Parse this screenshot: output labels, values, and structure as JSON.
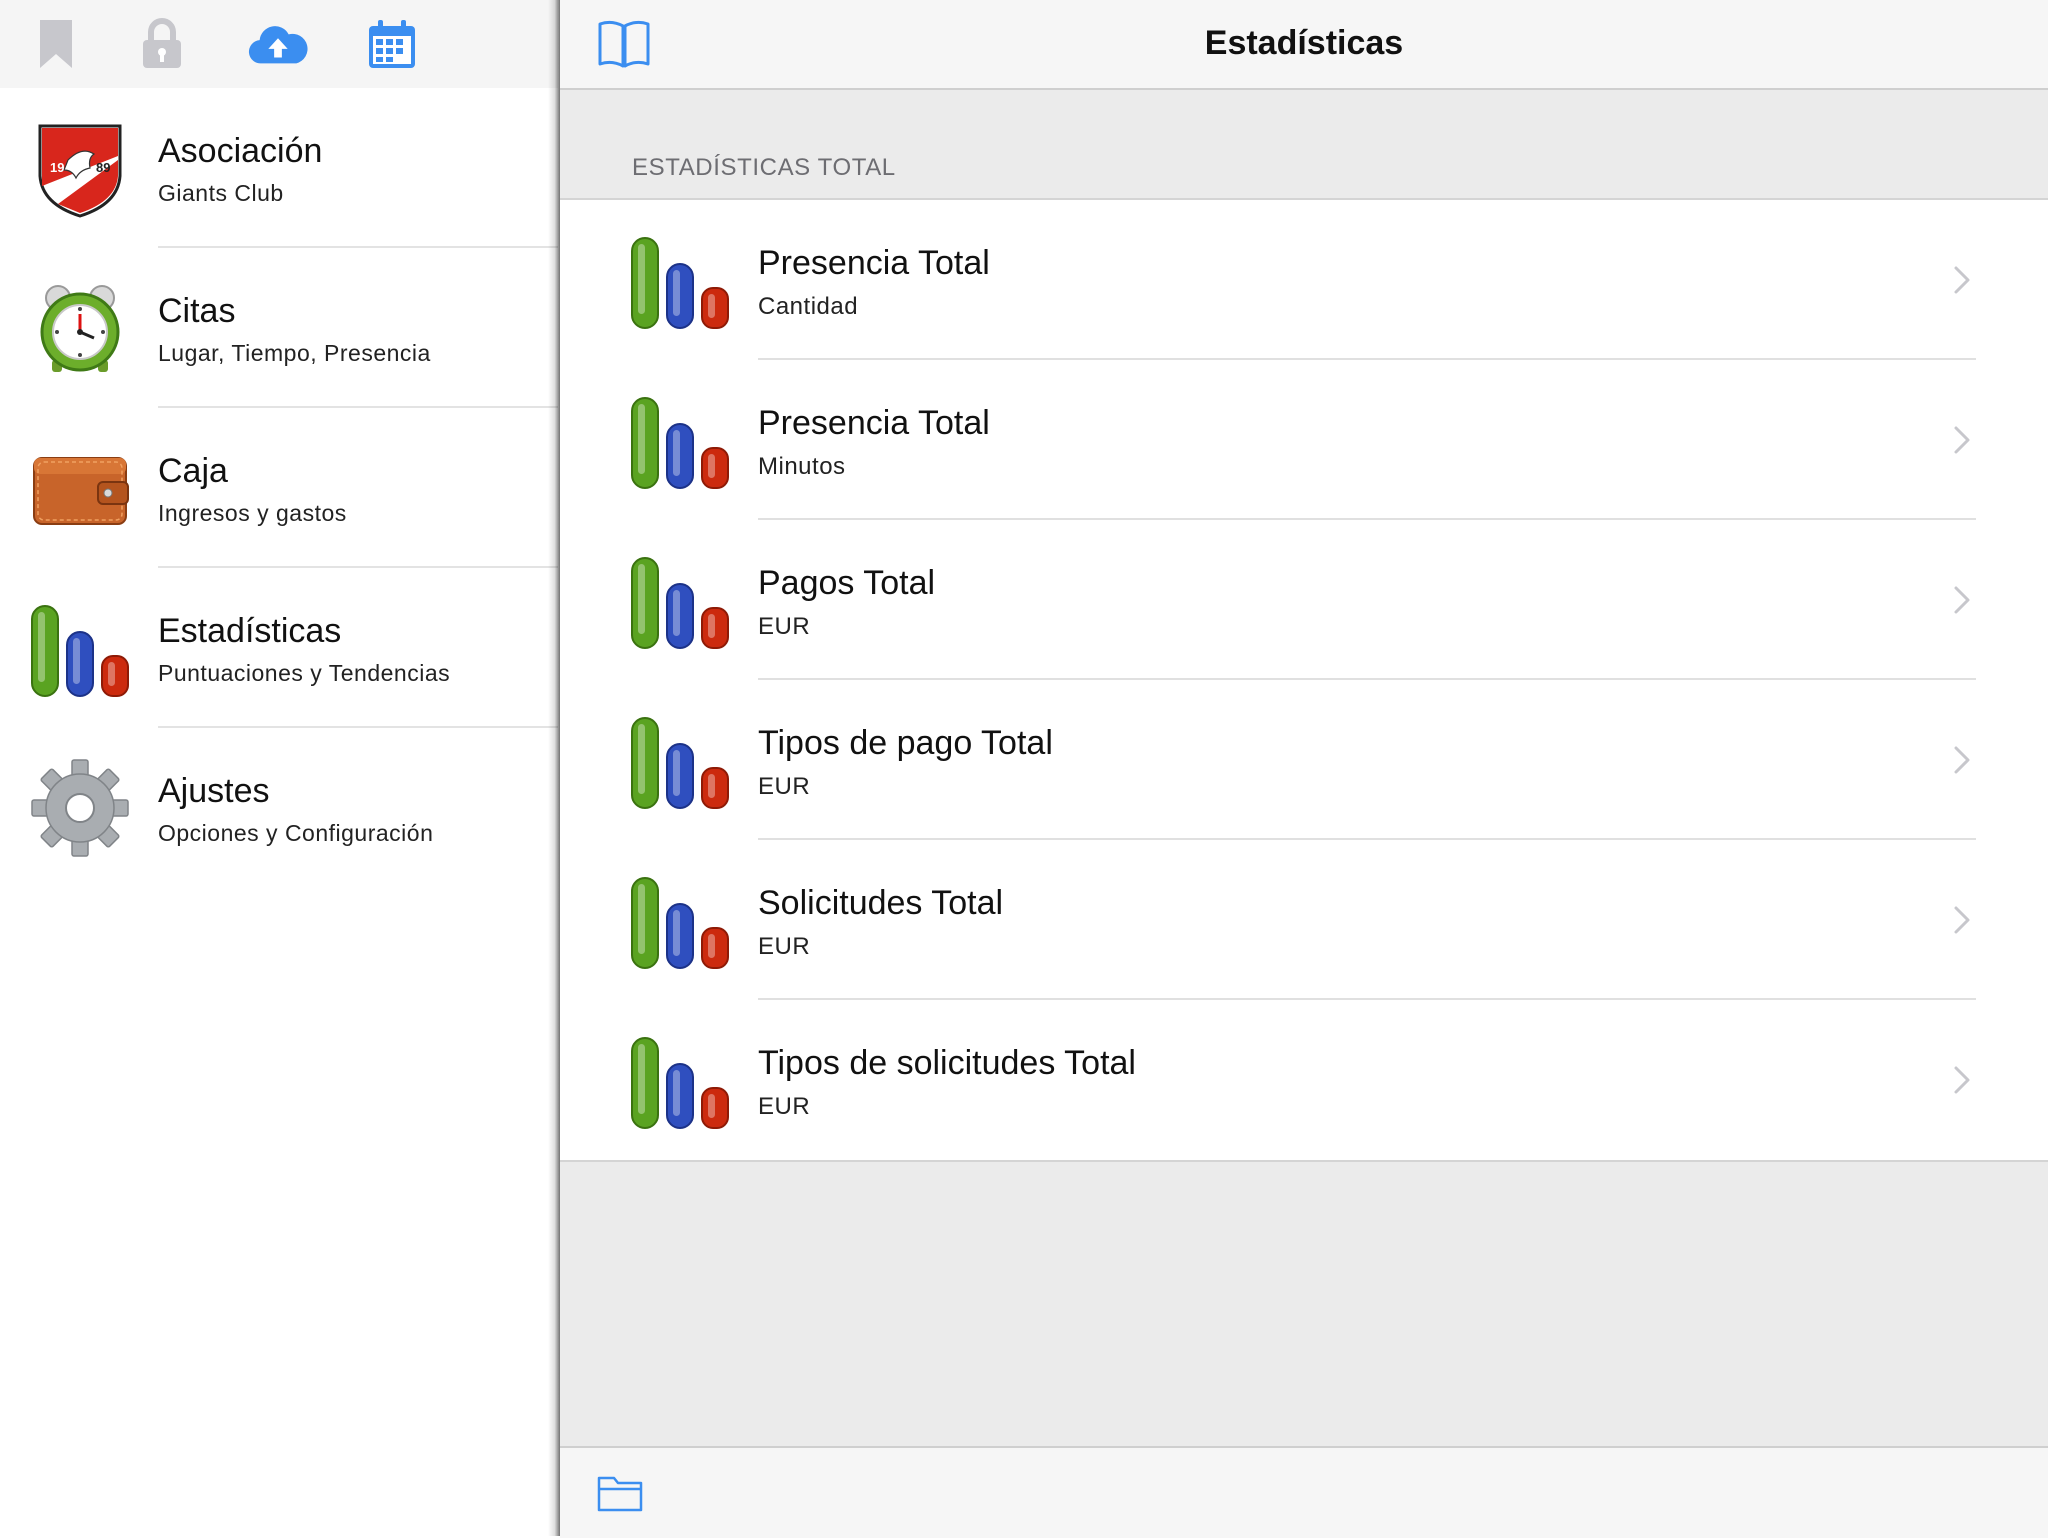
{
  "sidebar": {
    "toolbar": {
      "icons": [
        "bookmark-icon",
        "lock-icon",
        "cloud-upload-icon",
        "calendar-icon"
      ],
      "colors": {
        "inactive": "#c7c7cc",
        "active": "#3b8ef0"
      }
    },
    "items": [
      {
        "title": "Asociación",
        "subtitle": "Giants Club",
        "icon": "club-crest-icon"
      },
      {
        "title": "Citas",
        "subtitle": "Lugar, Tiempo, Presencia",
        "icon": "alarm-clock-icon"
      },
      {
        "title": "Caja",
        "subtitle": "Ingresos y gastos",
        "icon": "wallet-icon"
      },
      {
        "title": "Estadísticas",
        "subtitle": "Puntuaciones y Tendencias",
        "icon": "bar-chart-icon"
      },
      {
        "title": "Ajustes",
        "subtitle": "Opciones y Configuración",
        "icon": "gear-icon"
      }
    ],
    "crest_text": {
      "top": "",
      "left": "19",
      "right": "89"
    }
  },
  "main": {
    "title": "Estadísticas",
    "section_header": "ESTADÍSTICAS TOTAL",
    "rows": [
      {
        "title": "Presencia Total",
        "subtitle": "Cantidad"
      },
      {
        "title": "Presencia Total",
        "subtitle": "Minutos"
      },
      {
        "title": "Pagos Total",
        "subtitle": "EUR"
      },
      {
        "title": "Tipos de pago Total",
        "subtitle": "EUR"
      },
      {
        "title": "Solicitudes Total",
        "subtitle": "EUR"
      },
      {
        "title": "Tipos de solicitudes Total",
        "subtitle": "EUR"
      }
    ],
    "icons": {
      "left": "book-icon",
      "row": "bar-chart-icon",
      "row_accessory": "chevron-right-icon",
      "bottom": "folder-icon"
    },
    "colors": {
      "accent": "#3b8ef0",
      "bar_green": "#5aa321",
      "bar_blue": "#2f4fbf",
      "bar_red": "#cc2a0e"
    }
  }
}
